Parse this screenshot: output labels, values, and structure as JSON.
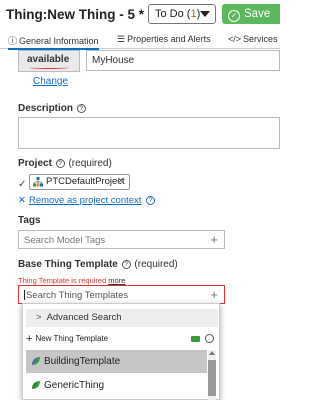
{
  "header": {
    "title_prefix": "Thing:",
    "title_name": "New Thing - 5 *",
    "help_glyph": "?",
    "state_label": "To Do (",
    "state_count": "1",
    "state_suffix": ")",
    "save_label": "Save"
  },
  "tabs": [
    {
      "label": "General Information",
      "icon": "info-icon"
    },
    {
      "label": "Properties and Alerts",
      "icon": "list-icon"
    },
    {
      "label": "Services",
      "icon": "code-icon"
    }
  ],
  "thumbnail": {
    "text": "available"
  },
  "name_value": "MyHouse",
  "change_label": "Change",
  "description": {
    "label": "Description"
  },
  "project": {
    "label": "Project",
    "required": "(required)",
    "value": "PTCDefaultProject",
    "remove_label": "Remove as project context"
  },
  "tags": {
    "label": "Tags",
    "placeholder": "Search Model Tags"
  },
  "base_template": {
    "label": "Base Thing Template",
    "required": "(required)",
    "error": "Thing Template is required",
    "more": "more",
    "placeholder": "Search Thing Templates"
  },
  "dropdown": {
    "advanced_search": "Advanced Search",
    "new_template": "New Thing Template",
    "items": [
      {
        "label": "BuildingTemplate",
        "selected": true
      },
      {
        "label": "GenericThing",
        "selected": false
      }
    ]
  },
  "colors": {
    "accent": "#1a6cc2",
    "save": "#5cb85c",
    "error": "#dd3333",
    "leaf": "#3c9a3c"
  }
}
